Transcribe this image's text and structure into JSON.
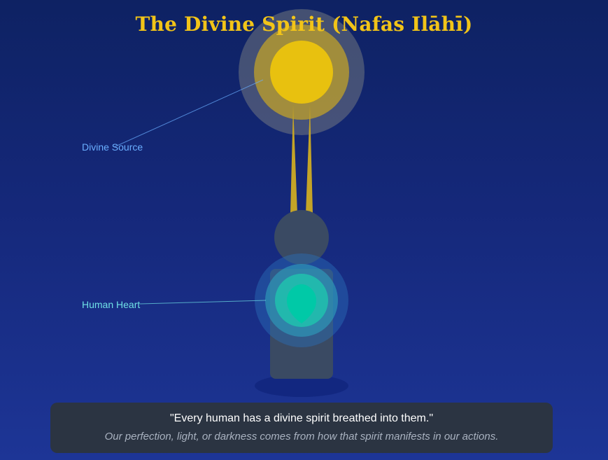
{
  "title": "The Divine Spirit (Nafas Ilāhī)",
  "labels": {
    "divine_source": "Divine Source",
    "human_heart": "Human Heart"
  },
  "quote": {
    "main": "\"Every human has a divine spirit breathed into them.\"",
    "sub": "Our perfection, light, or darkness comes from how that spirit manifests in our actions."
  },
  "colors": {
    "background_top": "#0e2263",
    "background_bottom": "#1d3596",
    "title": "#f2c418",
    "sun_core": "#e8c10f",
    "divine_source_label": "#6aaeff",
    "human_heart_label": "#6fe0e6",
    "figure": "#3a4a63",
    "heart_glow": "#00c9a7",
    "quote_box": "#2b3442"
  }
}
